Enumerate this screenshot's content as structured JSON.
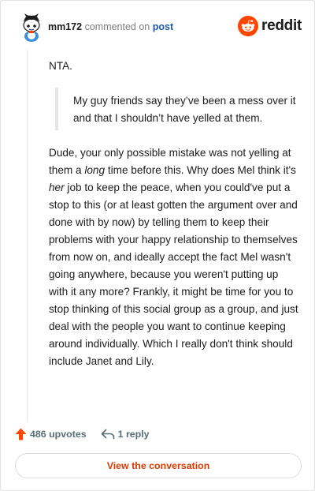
{
  "comment": {
    "username": "mm172",
    "action": "commented on",
    "post_link": "post"
  },
  "brand": {
    "logo_text": "reddit",
    "accent": "#ff4500"
  },
  "body": {
    "intro": "NTA.",
    "quote": "My guy friends say they’ve been a mess over it and that I shouldn’t have yelled at them.",
    "para_a": "Dude, your only possible mistake was not yelling at them a ",
    "para_a_em": "long",
    "para_b": " time before this. Why does Mel think it's ",
    "para_b_em": "her",
    "para_c": " job to keep the peace, when you could've put a stop to this (or at least gotten the argument over and done with by now) by telling them to keep their problems with your happy relationship to themselves from now on, and ideally accept the fact Mel wasn't going anywhere, because you weren't putting up with it any more? Frankly, it might be time for you to stop thinking of this social group as a group, and just deal with the people you want to continue keeping around individually. Which I really don't think should include Janet and Lily."
  },
  "footer": {
    "upvotes": "486 upvotes",
    "replies": "1 reply",
    "view_conversation": "View the conversation",
    "upvote_color": "#ff4500",
    "icons": [
      "upvote-arrow-icon",
      "reply-arrow-icon"
    ]
  }
}
